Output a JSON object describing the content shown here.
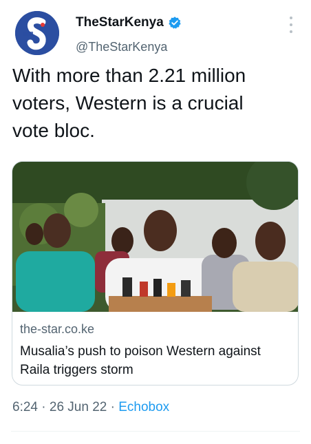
{
  "account": {
    "display_name": "TheStarKenya",
    "handle": "@TheStarKenya",
    "verified": true,
    "avatar_logo": "S"
  },
  "tweet": {
    "text": "With more than 2.21 million\nvoters, Western is a crucial\nvote bloc.",
    "time": "6:24",
    "separator": " · ",
    "date": "26 Jun 22",
    "source": "Echobox"
  },
  "link_card": {
    "domain": "the-star.co.ke",
    "title": "Musalia’s push to poison Western against Raila triggers storm"
  },
  "colors": {
    "accent": "#1d9bf0",
    "text_primary": "#0f1419",
    "text_secondary": "#536471",
    "avatar_bg": "#2b4ea1"
  },
  "icons": [
    "verified-badge-icon",
    "more-options-icon"
  ]
}
